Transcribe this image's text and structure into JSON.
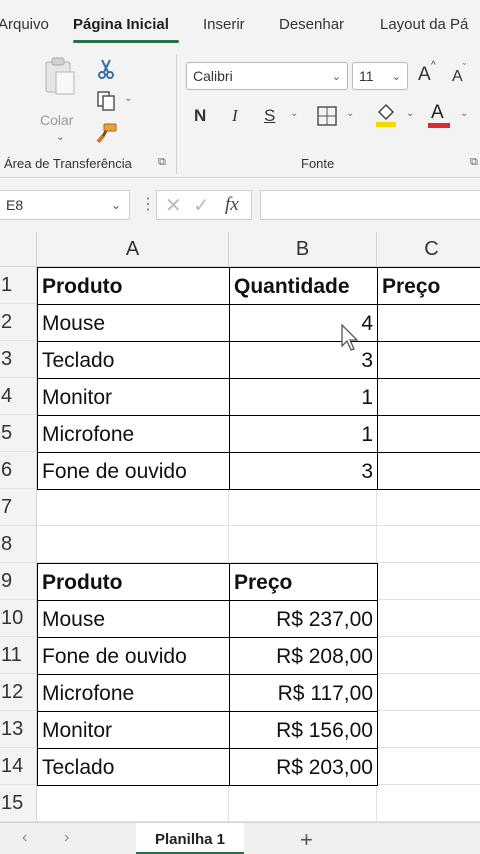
{
  "ribbon_tabs": [
    "Arquivo",
    "Página Inicial",
    "Inserir",
    "Desenhar",
    "Layout da Pá"
  ],
  "clipboard": {
    "paste_label": "Colar",
    "group_label": "Área de Transferência"
  },
  "font": {
    "name": "Calibri",
    "size": "11",
    "grow_label": "A",
    "shrink_label": "A",
    "bold_label": "N",
    "italic_label": "I",
    "underline_label": "S",
    "color_label": "A",
    "group_label": "Fonte"
  },
  "formula_bar": {
    "name_box": "E8",
    "fx_label": "fx",
    "formula": ""
  },
  "columns": [
    "A",
    "B",
    "C"
  ],
  "rows": [
    "1",
    "2",
    "3",
    "4",
    "5",
    "6",
    "7",
    "8",
    "9",
    "10",
    "11",
    "12",
    "13",
    "14",
    "15"
  ],
  "table1": {
    "headers": [
      "Produto",
      "Quantidade",
      "Preço"
    ],
    "rows": [
      [
        "Mouse",
        "4",
        ""
      ],
      [
        "Teclado",
        "3",
        ""
      ],
      [
        "Monitor",
        "1",
        ""
      ],
      [
        "Microfone",
        "1",
        ""
      ],
      [
        "Fone de ouvido",
        "3",
        ""
      ]
    ]
  },
  "table2": {
    "headers": [
      "Produto",
      "Preço"
    ],
    "rows": [
      [
        "Mouse",
        "R$ 237,00"
      ],
      [
        "Fone de ouvido",
        "R$ 208,00"
      ],
      [
        "Microfone",
        "R$ 117,00"
      ],
      [
        "Monitor",
        "R$ 156,00"
      ],
      [
        "Teclado",
        "R$ 203,00"
      ]
    ]
  },
  "sheets": {
    "active": "Planilha 1",
    "add_label": "+"
  },
  "colors": {
    "accent": "#217346",
    "highlight": "#f5d800",
    "font_color": "#d92b2b"
  },
  "icons": [
    "paste-icon",
    "cut-icon",
    "copy-icon",
    "format-painter-icon",
    "border-icon",
    "fill-color-icon",
    "font-color-icon",
    "dialog-launcher-icon",
    "cancel-icon",
    "enter-icon",
    "function-icon"
  ]
}
